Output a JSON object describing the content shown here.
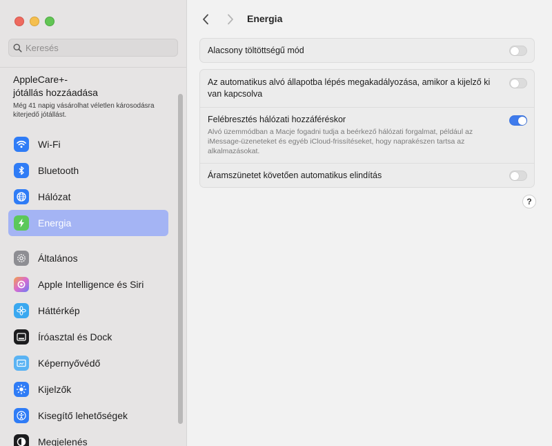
{
  "sidebar": {
    "search_placeholder": "Keresés",
    "applecare": {
      "title": "AppleCare+-\njótállás hozzáadása",
      "desc": "Még 41 napig vásárolhat véletlen károsodásra kiterjedő jótállást."
    },
    "items": [
      {
        "label": "Wi-Fi",
        "icon": "wifi-icon",
        "color": "#2f7cf6"
      },
      {
        "label": "Bluetooth",
        "icon": "bluetooth-icon",
        "color": "#2f7cf6"
      },
      {
        "label": "Hálózat",
        "icon": "globe-icon",
        "color": "#2f7cf6"
      },
      {
        "label": "Energia",
        "icon": "bolt-icon",
        "color": "#5cc85a",
        "active": true
      },
      {
        "label": "Általános",
        "icon": "gear-icon",
        "color": "#8e8e93"
      },
      {
        "label": "Apple Intelligence és Siri",
        "icon": "apple-intelligence-icon",
        "color": "#d86bd0"
      },
      {
        "label": "Háttérkép",
        "icon": "flower-icon",
        "color": "#3aa8f0"
      },
      {
        "label": "Íróasztal és Dock",
        "icon": "dock-icon",
        "color": "#1c1c1e"
      },
      {
        "label": "Képernyővédő",
        "icon": "screensaver-icon",
        "color": "#5ab3f3"
      },
      {
        "label": "Kijelzők",
        "icon": "brightness-icon",
        "color": "#2f7cf6"
      },
      {
        "label": "Kisegítő lehetőségek",
        "icon": "accessibility-icon",
        "color": "#2f7cf6"
      },
      {
        "label": "Megjelenés",
        "icon": "appearance-icon",
        "color": "#1c1c1e"
      }
    ]
  },
  "main": {
    "title": "Energia",
    "settings": [
      {
        "title": "Alacsony töltöttségű mód",
        "on": false
      },
      {
        "title": "Az automatikus alvó állapotba lépés megakadályozása, amikor a kijelző ki van kapcsolva",
        "on": false
      },
      {
        "title": "Felébresztés hálózati hozzáféréskor",
        "desc": "Alvó üzemmódban a Macje fogadni tudja a beérkező hálózati forgalmat, például az iMessage-üzeneteket és egyéb iCloud-frissítéseket, hogy naprakészen tartsa az alkalmazásokat.",
        "on": true
      },
      {
        "title": "Áramszünetet követően automatikus elindítás",
        "on": false
      }
    ],
    "help_label": "?"
  },
  "colors": {
    "accent": "#3f7bec",
    "active_nav_bg": "#a4b4f4"
  }
}
